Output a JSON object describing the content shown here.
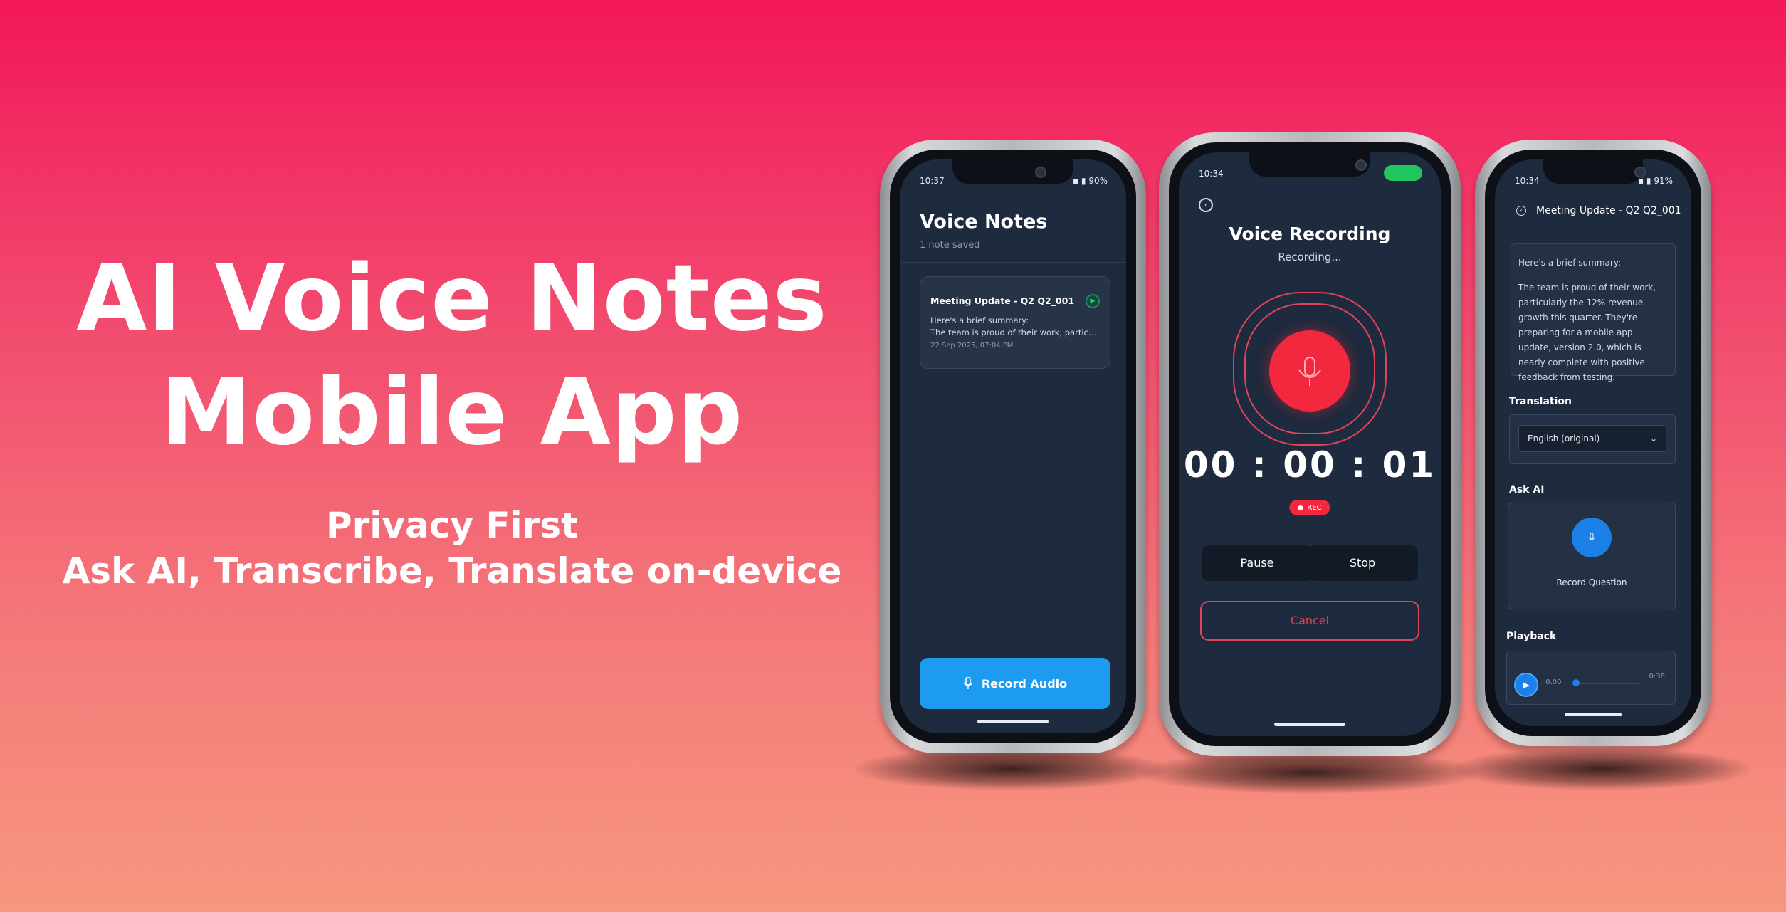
{
  "hero": {
    "title_line1": "AI Voice Notes",
    "title_line2": "Mobile App",
    "subtitle_line1": "Privacy First",
    "subtitle_line2": "Ask AI, Transcribe, Translate on-device"
  },
  "phone_list": {
    "status_time": "10:37",
    "status_battery": "90%",
    "title": "Voice Notes",
    "count_text": "1 note saved",
    "note": {
      "title": "Meeting Update - Q2 Q2_001",
      "line1": "Here's a brief summary:",
      "line2": "The team is proud of their work, particularly th...",
      "date": "22 Sep 2025, 07:04 PM",
      "play_icon": "play-circle-icon"
    },
    "record_button": "Record Audio",
    "record_icon": "microphone-icon"
  },
  "phone_recording": {
    "status_time": "10:34",
    "title": "Voice Recording",
    "subtitle": "Recording...",
    "timer": "00 : 00 : 01",
    "rec_badge": "REC",
    "pause_button": "Pause",
    "stop_button": "Stop",
    "cancel_button": "Cancel",
    "accent_color": "#f3283f"
  },
  "phone_detail": {
    "status_time": "10:34",
    "status_battery": "91%",
    "title": "Meeting Update - Q2 Q2_001",
    "summary_line1": "Here's a brief summary:",
    "summary_body": "The team is proud of their work, particularly the 12% revenue growth this quarter. They're preparing for a mobile app update, version 2.0, which is nearly complete with positive feedback from testing.",
    "translation_label": "Translation",
    "translation_value": "English (original)",
    "ask_ai_label": "Ask AI",
    "record_question": "Record Question",
    "playback_label": "Playback",
    "playback_start": "0:00",
    "playback_end": "0:38",
    "playback_progress": 0.0
  },
  "colors": {
    "background_top": "#f2175a",
    "background_bottom": "#f7977f",
    "screen_bg": "#1e2a3d",
    "primary_blue": "#1d9bf0",
    "record_red": "#f3283f"
  }
}
